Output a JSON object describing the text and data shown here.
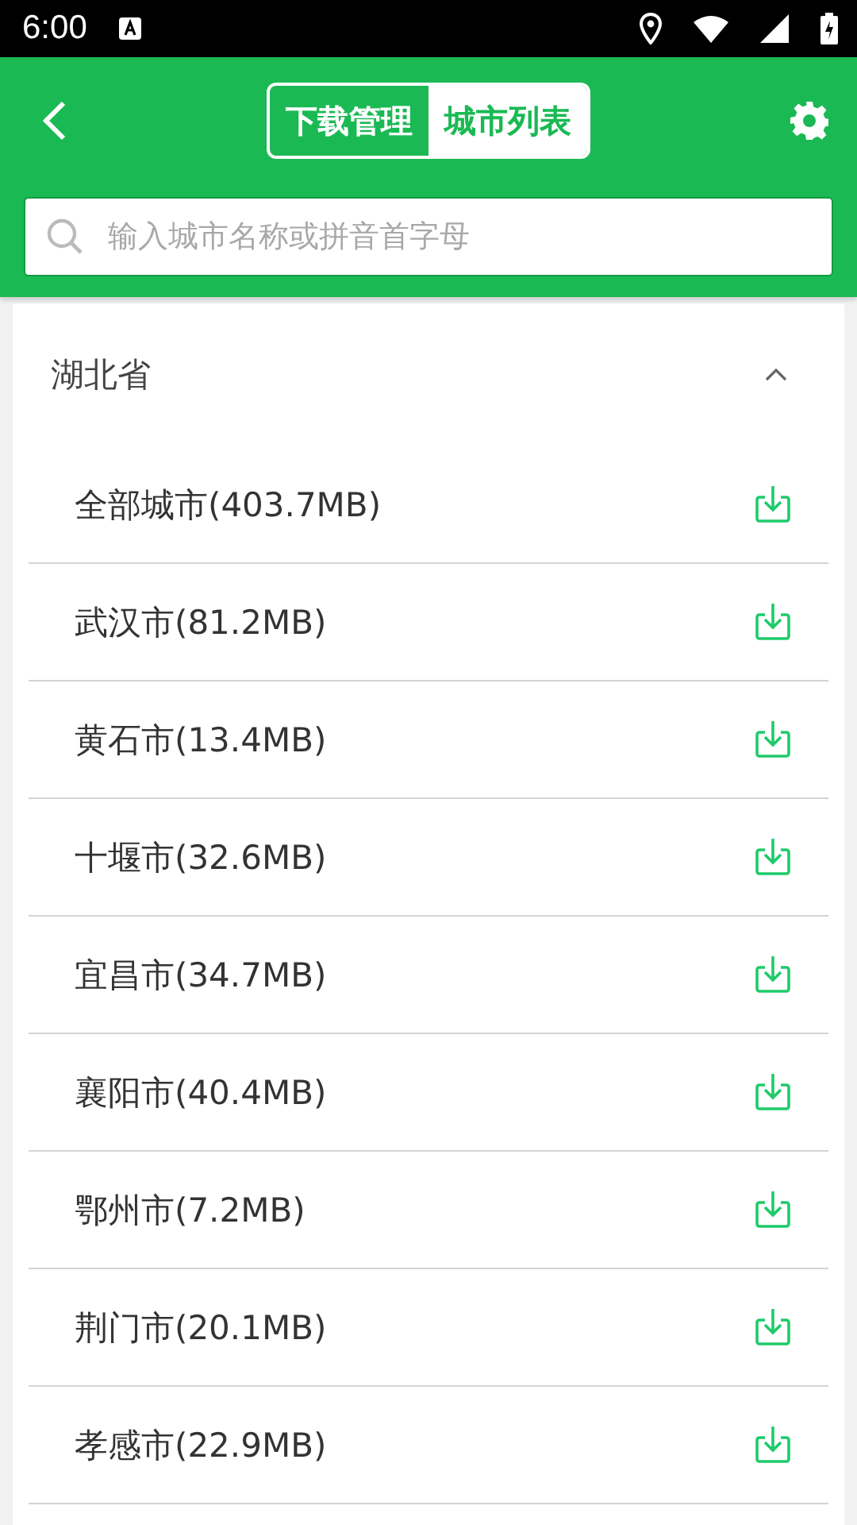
{
  "status_bar": {
    "time": "6:00"
  },
  "tabs": [
    {
      "label": "下载管理",
      "selected": false
    },
    {
      "label": "城市列表",
      "selected": true
    }
  ],
  "search": {
    "placeholder": "输入城市名称或拼音首字母"
  },
  "province": {
    "name": "湖北省",
    "expanded": true
  },
  "cities": [
    {
      "label": "全部城市(403.7MB)"
    },
    {
      "label": "武汉市(81.2MB)"
    },
    {
      "label": "黄石市(13.4MB)"
    },
    {
      "label": "十堰市(32.6MB)"
    },
    {
      "label": "宜昌市(34.7MB)"
    },
    {
      "label": "襄阳市(40.4MB)"
    },
    {
      "label": "鄂州市(7.2MB)"
    },
    {
      "label": "荆门市(20.1MB)"
    },
    {
      "label": "孝感市(22.9MB)"
    }
  ]
}
